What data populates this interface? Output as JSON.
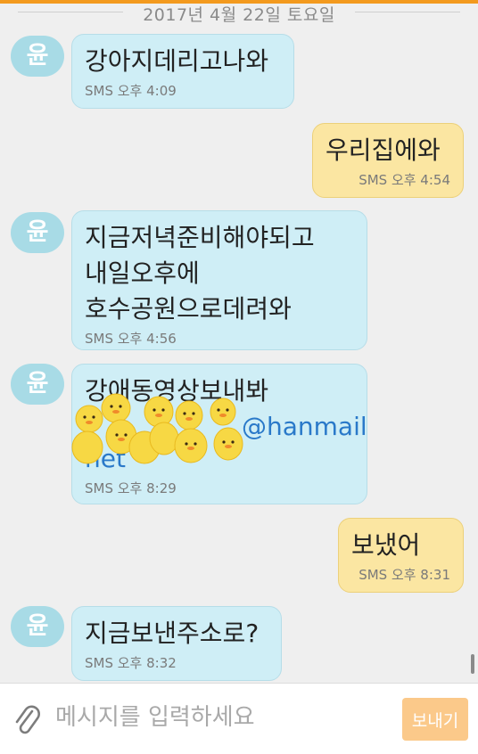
{
  "colors": {
    "accent": "#f39a1e",
    "incoming_bubble": "#cfeef6",
    "outgoing_bubble": "#fbe6a2",
    "avatar": "#a8dbe6",
    "send_button": "#fbc98a"
  },
  "date_divider": "2017년 4월 22일 토요일",
  "messages": [
    {
      "direction": "incoming",
      "sender_initial": "윤",
      "text": "강아지데리고나와",
      "meta": "SMS 오후 4:09"
    },
    {
      "direction": "outgoing",
      "text": "우리집에와",
      "meta": "SMS 오후 4:54"
    },
    {
      "direction": "incoming",
      "sender_initial": "윤",
      "text": "지금저녁준비해야되고\n내일오후에\n호수공원으로데려와",
      "meta": "SMS 오후 4:56"
    },
    {
      "direction": "incoming",
      "sender_initial": "윤",
      "text": "강애동영상보내봐",
      "link_fragment_1": "@hanmail",
      "link_fragment_2": "net",
      "sticker": "duck-stickers",
      "meta": "SMS 오후 8:29"
    },
    {
      "direction": "outgoing",
      "text": "보냈어",
      "meta": "SMS 오후 8:31"
    },
    {
      "direction": "incoming",
      "sender_initial": "윤",
      "text": "지금보낸주소로?",
      "meta": "SMS 오후 8:32"
    }
  ],
  "composer": {
    "attach_icon": "paperclip-icon",
    "placeholder": "메시지를 입력하세요",
    "send_label": "보내기"
  }
}
